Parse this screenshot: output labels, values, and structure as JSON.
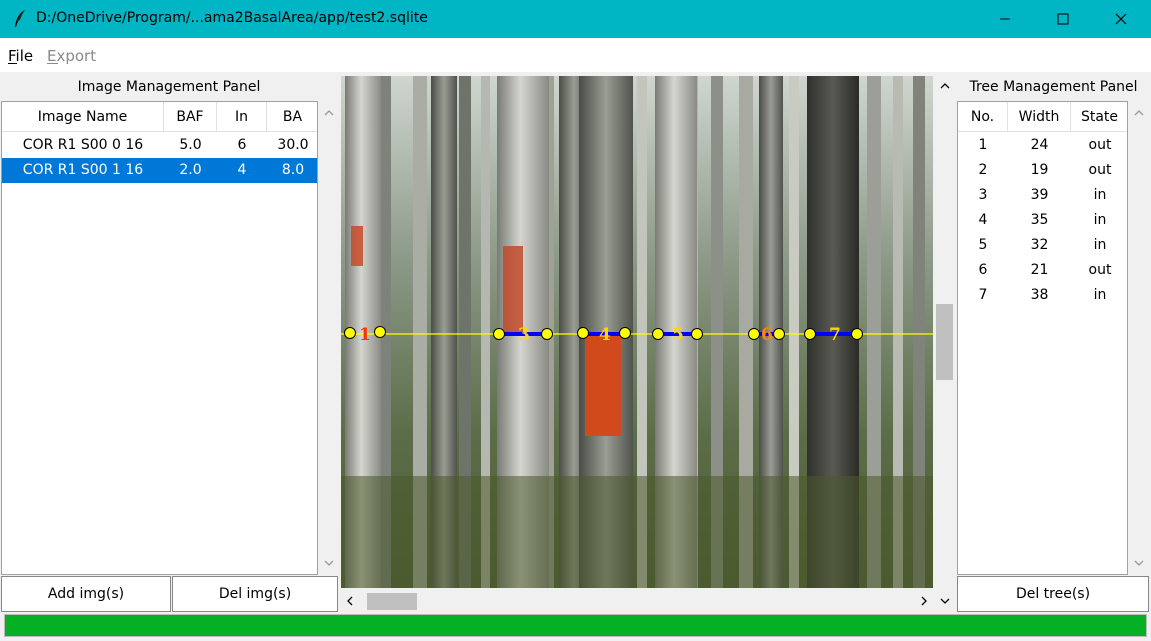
{
  "window": {
    "title": "D:/OneDrive/Program/...ama2BasalArea/app/test2.sqlite"
  },
  "menu": {
    "file": "File",
    "export": "Export"
  },
  "image_panel": {
    "label": "Image Management Panel",
    "columns": [
      "Image Name",
      "BAF",
      "In",
      "BA"
    ],
    "rows": [
      {
        "name": "COR R1 S00 0 16",
        "baf": "5.0",
        "in": "6",
        "ba": "30.0",
        "selected": false
      },
      {
        "name": "COR R1 S00 1 16",
        "baf": "2.0",
        "in": "4",
        "ba": "8.0",
        "selected": true
      }
    ],
    "add_button": "Add img(s)",
    "del_button": "Del img(s)"
  },
  "tree_panel": {
    "label": "Tree Management Panel",
    "columns": [
      "No.",
      "Width",
      "State"
    ],
    "rows": [
      {
        "no": "1",
        "width": "24",
        "state": "out"
      },
      {
        "no": "2",
        "width": "19",
        "state": "out"
      },
      {
        "no": "3",
        "width": "39",
        "state": "in"
      },
      {
        "no": "4",
        "width": "35",
        "state": "in"
      },
      {
        "no": "5",
        "width": "32",
        "state": "in"
      },
      {
        "no": "6",
        "width": "21",
        "state": "out"
      },
      {
        "no": "7",
        "width": "38",
        "state": "in"
      }
    ],
    "del_button": "Del tree(s)"
  },
  "canvas": {
    "markers": [
      "1",
      "3",
      "4",
      "5",
      "6",
      "7"
    ],
    "line_color": "#ffff00",
    "segment_color": "#0000ff",
    "point_color": "#ffff00",
    "label_colors": {
      "out": "#ff3300",
      "in": "#ffd700"
    }
  },
  "progress": {
    "value": 1.0,
    "color": "#06b025"
  },
  "colors": {
    "titlebar": "#00b6c4",
    "selection": "#0078d7"
  }
}
